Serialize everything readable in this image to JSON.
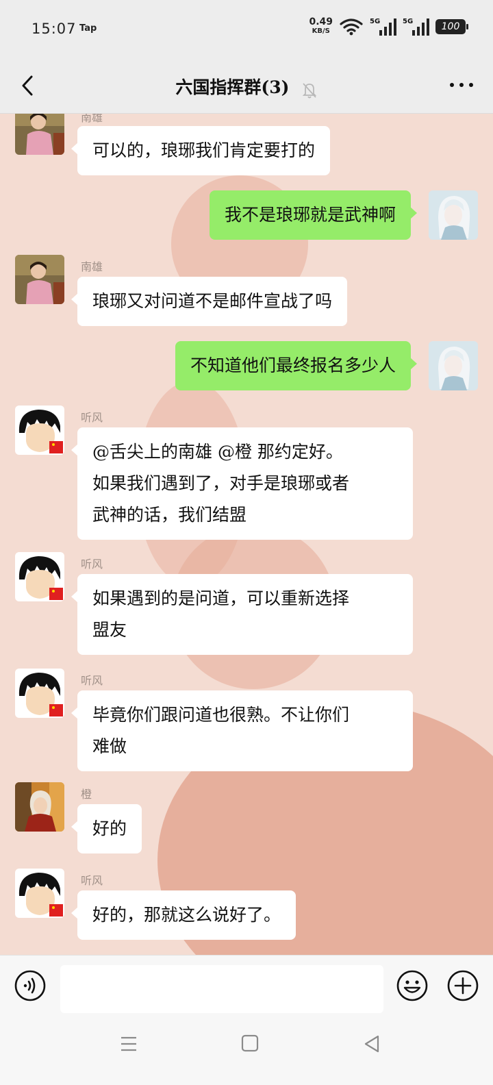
{
  "status_bar": {
    "time": "15:07",
    "app_tag": "Tap",
    "speed_value": "0.49",
    "speed_unit": "KB/S",
    "signal1_label": "5G",
    "signal2_label": "5G",
    "battery": "100"
  },
  "header": {
    "title": "六国指挥群(3)",
    "back_icon": "chevron-left-icon",
    "mute_icon": "bell-off-icon",
    "more_icon": "more-dots-icon"
  },
  "messages": [
    {
      "sender": "南雄",
      "text": "可以的，琅琊我们肯定要打的",
      "side": "in",
      "avatar": "nanxiong"
    },
    {
      "sender": "",
      "text": "我不是琅琊就是武神啊",
      "side": "out",
      "avatar": "self"
    },
    {
      "sender": "南雄",
      "text": "琅琊又对问道不是邮件宣战了吗",
      "side": "in",
      "avatar": "nanxiong"
    },
    {
      "sender": "",
      "text": "不知道他们最终报名多少人",
      "side": "out",
      "avatar": "self"
    },
    {
      "sender": "听风",
      "lines": [
        "@舌尖上的南雄 @橙  那约定好。",
        "如果我们遇到了，对手是琅琊或者",
        "武神的话，我们结盟"
      ],
      "side": "in",
      "avatar": "tingfeng"
    },
    {
      "sender": "听风",
      "lines": [
        "如果遇到的是问道，可以重新选择",
        "盟友"
      ],
      "side": "in",
      "avatar": "tingfeng"
    },
    {
      "sender": "听风",
      "lines": [
        "毕竟你们跟问道也很熟。不让你们",
        "难做"
      ],
      "side": "in",
      "avatar": "tingfeng"
    },
    {
      "sender": "橙",
      "text": "好的",
      "side": "in",
      "avatar": "cheng"
    },
    {
      "sender": "听风",
      "text": "好的，那就这么说好了。",
      "side": "in",
      "avatar": "tingfeng"
    }
  ],
  "input_bar": {
    "voice_icon": "voice-icon",
    "emoji_icon": "emoji-icon",
    "plus_icon": "plus-icon",
    "text_value": ""
  },
  "nav_bar": {
    "menu_icon": "menu-icon",
    "home_icon": "home-square-icon",
    "back_icon": "back-triangle-icon"
  },
  "colors": {
    "outgoing_bubble": "#95ec69",
    "incoming_bubble": "#ffffff",
    "chat_background": "#f4dcd2",
    "chrome": "#ededed"
  }
}
